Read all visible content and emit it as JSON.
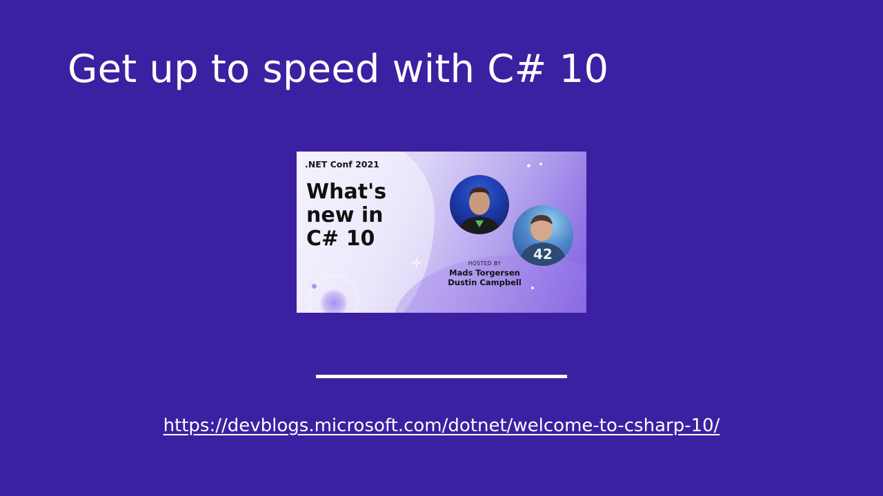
{
  "slide": {
    "title": "Get up to speed with C# 10",
    "link_text": "https://devblogs.microsoft.com/dotnet/welcome-to-csharp-10/",
    "background_color": "#3b21a1"
  },
  "thumbnail": {
    "event": ".NET Conf 2021",
    "title": "What's new in C# 10",
    "hosted_by": "HOSTED BY",
    "hosts": [
      "Mads Torgersen",
      "Dustin Campbell"
    ],
    "speaker_2_shirt_number": "42"
  }
}
